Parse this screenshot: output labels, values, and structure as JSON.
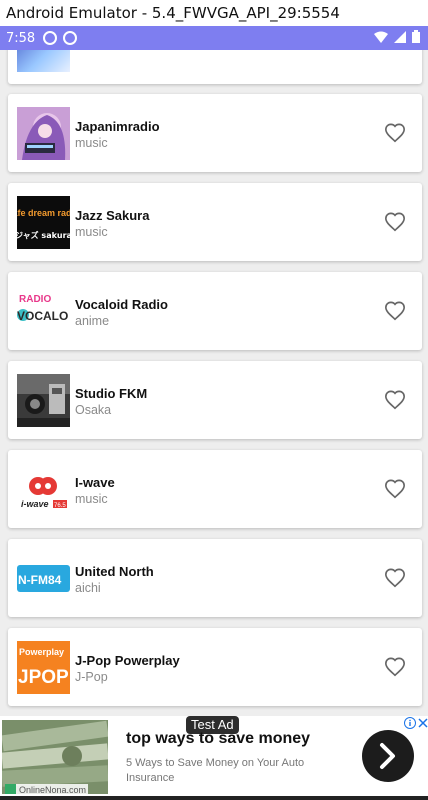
{
  "window": {
    "title": "Android Emulator - 5.4_FWVGA_API_29:5554"
  },
  "status_bar": {
    "time": "7:58",
    "color": "#7e7ef0"
  },
  "stations": [
    {
      "name": "Japanimradio",
      "genre": "music",
      "thumb": "anime-art"
    },
    {
      "name": "Jazz Sakura",
      "genre": "music",
      "thumb": "jazz-sakura-logo"
    },
    {
      "name": "Vocaloid Radio",
      "genre": "anime",
      "thumb": "vocaloid-logo"
    },
    {
      "name": "Studio FKM",
      "genre": "Osaka",
      "thumb": "studio-photo"
    },
    {
      "name": "I-wave",
      "genre": "music",
      "thumb": "iwave-logo"
    },
    {
      "name": "United North",
      "genre": "aichi",
      "thumb": "nfm-logo"
    },
    {
      "name": "J-Pop Powerplay",
      "genre": "J-Pop",
      "thumb": "jpop-logo"
    }
  ],
  "logos": {
    "jazz_top": "cafe dream radio",
    "jazz_bottom": "ジャズ sakura",
    "vocaloid": "VOCALO",
    "vocaloid_top": "RADIO",
    "iwave": "i-wave",
    "iwave_freq": "76.5",
    "nfm": "N-FM84",
    "jpop_top": "Powerplay",
    "jpop_main": "JPOP"
  },
  "ad": {
    "badge": "Test Ad",
    "title": "top ways to save money",
    "description": "5 Ways to Save Money on Your Auto Insurance",
    "source": "OnlineNona.com",
    "accent": "#1a73e8"
  }
}
